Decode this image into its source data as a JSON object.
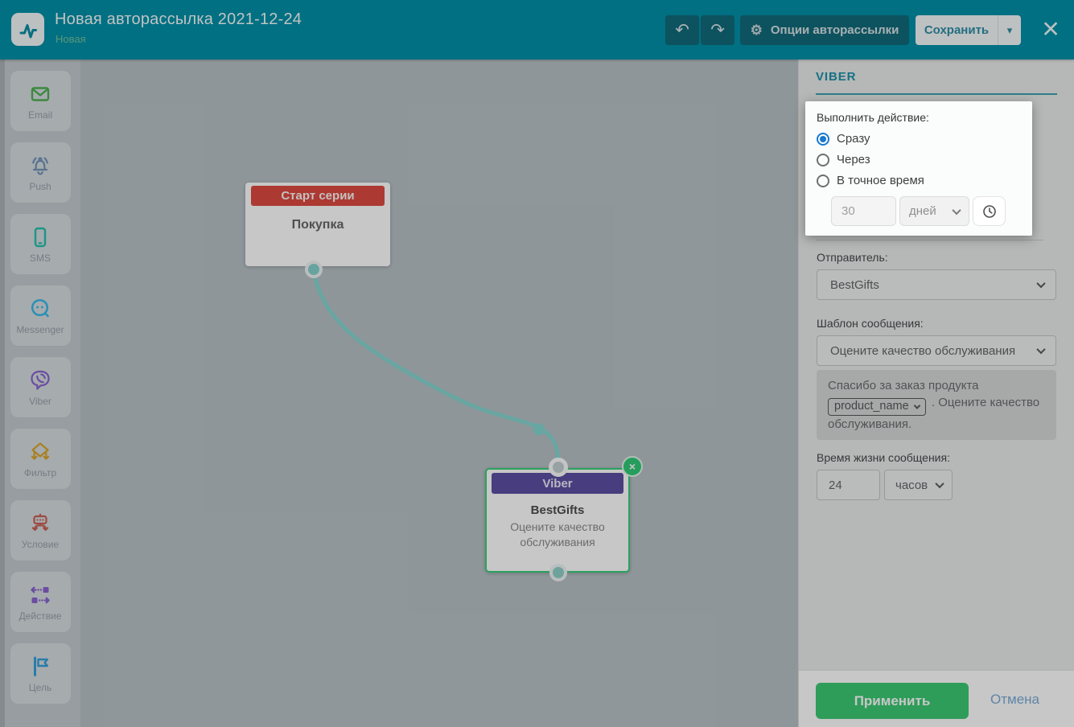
{
  "colors": {
    "header_teal": "#0090a7",
    "accent_teal": "#1b92a8",
    "apply_green": "#3cca72",
    "selection_green": "#37d07a",
    "start_node_red": "#dd4a40",
    "viber_purple": "#5d4fa3",
    "radio_blue": "#1878d2",
    "connector_teal": "#86d5d0"
  },
  "icons": {
    "undo": "↶",
    "redo": "↷",
    "gear": "⚙",
    "close": "×",
    "caret_down": "▾",
    "node_close": "×"
  },
  "header": {
    "title": "Новая авторассылка 2021-12-24",
    "subtitle": "Новая",
    "options_button": "Опции авторассылки",
    "save_button": "Сохранить"
  },
  "sidebar": {
    "items": [
      {
        "label": "Email"
      },
      {
        "label": "Push"
      },
      {
        "label": "SMS"
      },
      {
        "label": "Messenger"
      },
      {
        "label": "Viber"
      },
      {
        "label": "Фильтр"
      },
      {
        "label": "Условие"
      },
      {
        "label": "Действие"
      },
      {
        "label": "Цель"
      }
    ]
  },
  "canvas": {
    "start_node": {
      "header": "Старт серии",
      "body": "Покупка"
    },
    "viber_node": {
      "header": "Viber",
      "title": "BestGifts",
      "subtitle": "Оцените качество обслуживания"
    }
  },
  "panel": {
    "heading": "VIBER",
    "action_popover": {
      "label": "Выполнить действие:",
      "options": [
        "Сразу",
        "Через",
        "В точное время"
      ],
      "selected_index": 0,
      "delay_value": "30",
      "delay_unit": "дней"
    },
    "sender": {
      "label": "Отправитель:",
      "value": "BestGifts"
    },
    "template": {
      "label": "Шаблон сообщения:",
      "value": "Оцените качество обслуживания",
      "preview_prefix": "Спасибо за заказ продукта",
      "preview_variable": "product_name",
      "preview_suffix": ". Оцените качество обслуживания."
    },
    "ttl": {
      "label": "Время жизни сообщения:",
      "value": "24",
      "unit": "часов"
    },
    "apply_button": "Применить",
    "cancel_button": "Отмена"
  }
}
